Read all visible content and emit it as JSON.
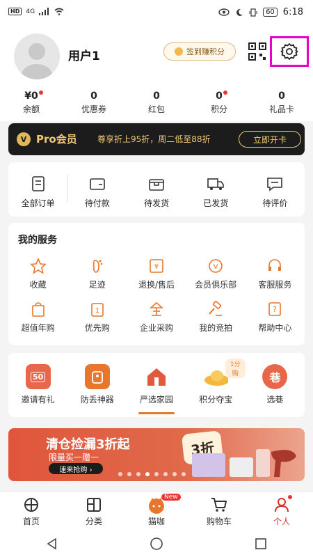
{
  "status_bar": {
    "left": "HD",
    "network": "4G",
    "battery": "60",
    "time": "6:18"
  },
  "header": {
    "username": "用户1",
    "signin_label": "签到赚积分"
  },
  "assets": [
    {
      "value": "¥0",
      "label": "余额",
      "dot": true
    },
    {
      "value": "0",
      "label": "优惠券",
      "dot": false
    },
    {
      "value": "0",
      "label": "红包",
      "dot": false
    },
    {
      "value": "0",
      "label": "积分",
      "dot": true
    },
    {
      "value": "0",
      "label": "礼品卡",
      "dot": false
    }
  ],
  "pro": {
    "name": "Pro会员",
    "desc": "尊享折上95折，周二低至88折",
    "button": "立即开卡"
  },
  "orders": [
    "全部订单",
    "待付款",
    "待发货",
    "已发货",
    "待评价"
  ],
  "services": {
    "title": "我的服务",
    "items": [
      "收藏",
      "足迹",
      "退换/售后",
      "会员俱乐部",
      "客服服务",
      "超值年购",
      "优先购",
      "企业采购",
      "我的竞拍",
      "帮助中心"
    ]
  },
  "features": {
    "items": [
      "邀请有礼",
      "防丢神器",
      "严选家园",
      "积分夺宝",
      "选巷"
    ],
    "pill": "1分购",
    "invite_badge": "50",
    "xuanxiang_glyph": "巷"
  },
  "banner": {
    "title": "清仓捡漏3折起",
    "subtitle": "限量买一赠一",
    "button": "速来抢购 ›",
    "badge": "3折"
  },
  "tabbar": {
    "items": [
      "首页",
      "分类",
      "猫咖",
      "购物车",
      "个人"
    ],
    "new_badge": "New",
    "active": "个人"
  },
  "colors": {
    "accent": "#e8772b",
    "active": "#d9302a",
    "highlight": "#e600c8",
    "pro_gold": "#f0c978"
  }
}
